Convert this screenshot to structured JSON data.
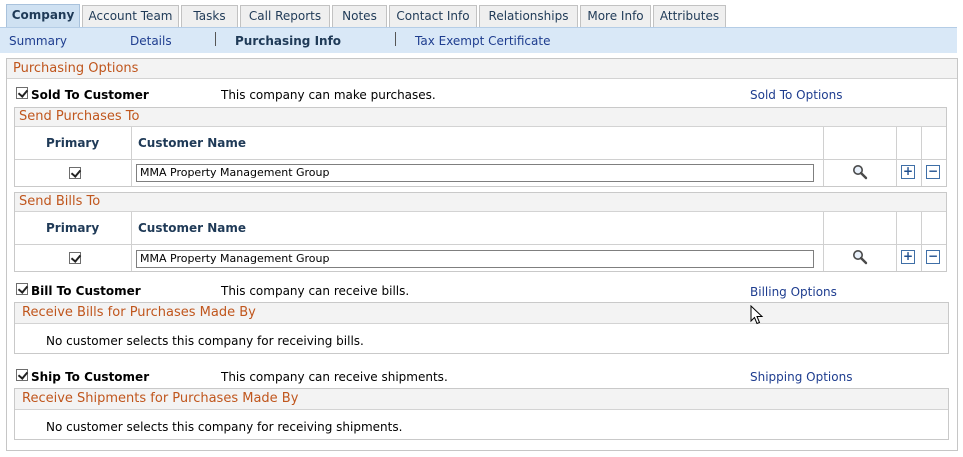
{
  "tabs": [
    {
      "label": "Company",
      "active": true
    },
    {
      "label": "Account Team"
    },
    {
      "label": "Tasks"
    },
    {
      "label": "Call Reports"
    },
    {
      "label": "Notes"
    },
    {
      "label": "Contact Info"
    },
    {
      "label": "Relationships"
    },
    {
      "label": "More Info"
    },
    {
      "label": "Attributes"
    }
  ],
  "subnav": {
    "summary": "Summary",
    "details": "Details",
    "purchasing": "Purchasing Info",
    "tax": "Tax Exempt Certificate"
  },
  "purchasing": {
    "title": "Purchasing Options",
    "sold_to": {
      "label": "Sold To Customer",
      "description": "This company can make purchases.",
      "link": "Sold To Options",
      "checked": true
    },
    "send_purchases": {
      "title": "Send Purchases To",
      "col_primary": "Primary",
      "col_customer": "Customer Name",
      "row": {
        "primary": true,
        "customer": "MMA Property Management Group"
      }
    },
    "send_bills": {
      "title": "Send Bills To",
      "col_primary": "Primary",
      "col_customer": "Customer Name",
      "row": {
        "primary": true,
        "customer": "MMA Property Management Group"
      }
    },
    "bill_to": {
      "label": "Bill To Customer",
      "description": "This company can receive bills.",
      "link": "Billing Options",
      "checked": true
    },
    "receive_bills": {
      "title": "Receive Bills for Purchases Made By",
      "message": "No customer selects this company for receiving bills."
    },
    "ship_to": {
      "label": "Ship To Customer",
      "description": "This company can receive shipments.",
      "link": "Shipping Options",
      "checked": true
    },
    "receive_shipments": {
      "title": "Receive Shipments for Purchases Made By",
      "message": "No customer selects this company for receiving shipments."
    }
  },
  "icons": {
    "lookup": "magnifier-icon",
    "add": "+",
    "delete": "−",
    "cursor": "mouse-pointer-icon"
  }
}
